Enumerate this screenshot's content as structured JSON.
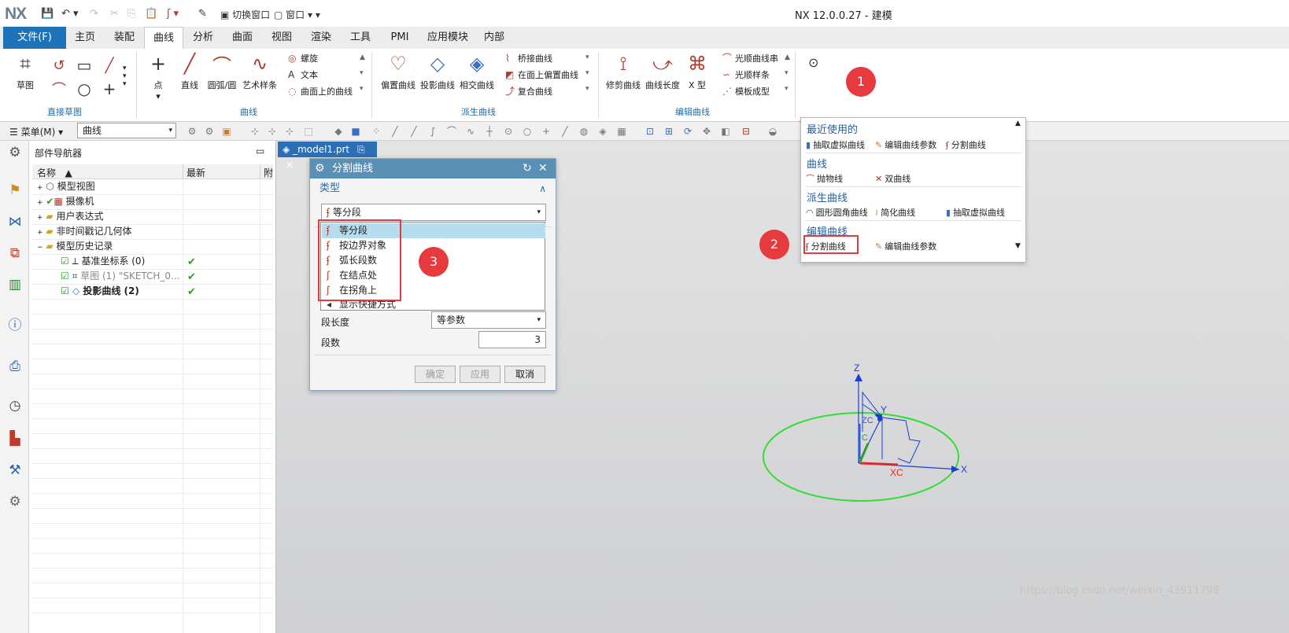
{
  "titlebar": {
    "logo": "NX",
    "quick_access": [
      "切换窗口",
      "窗口"
    ],
    "window_title": "NX 12.0.0.27 - 建模"
  },
  "tabs": [
    "文件(F)",
    "主页",
    "装配",
    "曲线",
    "分析",
    "曲面",
    "视图",
    "渲染",
    "工具",
    "PMI",
    "应用模块",
    "内部"
  ],
  "active_tab": "曲线",
  "ribbon": {
    "sketch": "草图",
    "direct_sketch_group": "直接草图",
    "curve_buttons": [
      "点",
      "直线",
      "圆弧/圆",
      "艺术样条"
    ],
    "curve_small": [
      "螺旋",
      "文本",
      "曲面上的曲线"
    ],
    "curve_group": "曲线",
    "derived_buttons": [
      "偏置曲线",
      "投影曲线",
      "相交曲线"
    ],
    "derived_small": [
      "桥接曲线",
      "在面上偏置曲线",
      "复合曲线"
    ],
    "derived_group": "派生曲线",
    "edit_buttons": [
      "修剪曲线",
      "曲线长度",
      "X 型"
    ],
    "edit_small": [
      "光顺曲线串",
      "光顺样条",
      "模板成型"
    ],
    "edit_group": "编辑曲线",
    "more": "更多"
  },
  "toolbar2": {
    "menu": "菜单(M)",
    "filter_value": "曲线"
  },
  "navigator": {
    "title": "部件导航器",
    "col_name": "名称",
    "col_latest": "最新",
    "col_extra": "附",
    "rows": [
      {
        "label": "模型视图",
        "check": false
      },
      {
        "label": "摄像机",
        "check": false
      },
      {
        "label": "用户表达式",
        "check": false
      },
      {
        "label": "非时间戳记几何体",
        "check": false
      },
      {
        "label": "模型历史记录",
        "check": false
      },
      {
        "label": "基准坐标系 (0)",
        "check": true
      },
      {
        "label": "草图 (1) \"SKETCH_0...",
        "check": true
      },
      {
        "label": "投影曲线 (2)",
        "check": true
      }
    ]
  },
  "doc_tab": "_model1.prt",
  "dialog": {
    "title": "分割曲线",
    "section_type": "类型",
    "type_value": "等分段",
    "options": [
      "等分段",
      "按边界对象",
      "弧长段数",
      "在结点处",
      "在拐角上"
    ],
    "show_shortcuts": "显示快捷方式",
    "seg_length_label": "段长度",
    "seg_length_value": "等参数",
    "seg_count_label": "段数",
    "seg_count_value": "3",
    "ok": "确定",
    "apply": "应用",
    "cancel": "取消"
  },
  "more_menu": {
    "recent_header": "最近使用的",
    "recent_items": [
      "抽取虚拟曲线",
      "编辑曲线参数",
      "分割曲线"
    ],
    "curve_header": "曲线",
    "curve_items": [
      "抛物线",
      "双曲线"
    ],
    "derived_header": "派生曲线",
    "derived_items": [
      "圆形圆角曲线",
      "简化曲线",
      "抽取虚拟曲线"
    ],
    "edit_header": "编辑曲线",
    "edit_items": [
      "分割曲线",
      "编辑曲线参数"
    ]
  },
  "annotations": [
    "1",
    "2",
    "3"
  ],
  "viewport": {
    "axis_x": "X",
    "axis_y": "Y",
    "axis_z": "Z",
    "label_xc": "XC",
    "label_zc": "ZC",
    "label_c": "C"
  },
  "watermark": "https://blog.csdn.net/weixin_43911798",
  "colors": {
    "accent": "#1e73b8",
    "annotation": "#e63a3f",
    "circle": "#33dd33",
    "axis": "#1a3fd4"
  }
}
